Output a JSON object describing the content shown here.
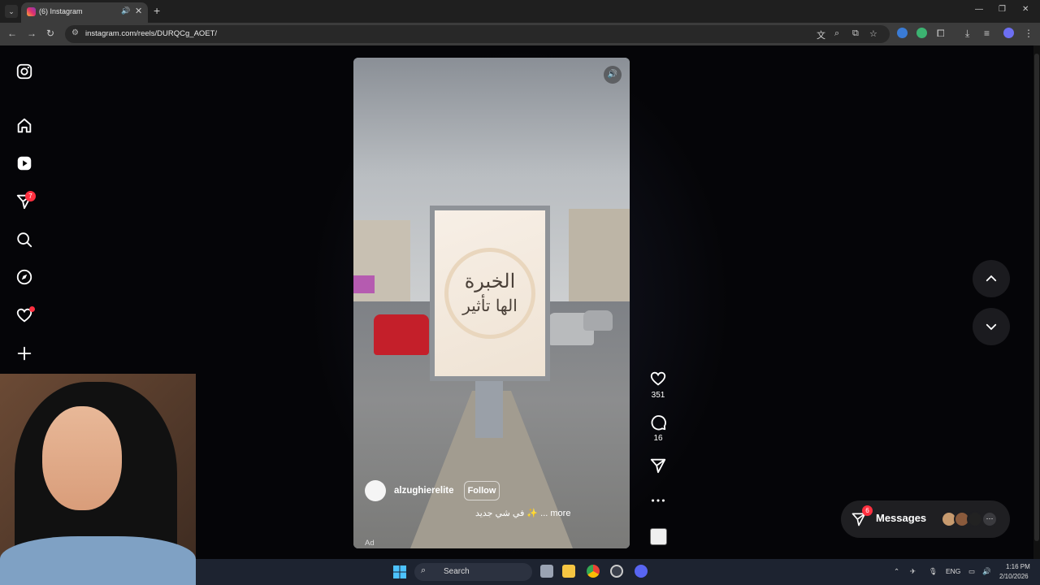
{
  "browser": {
    "tab_title": "(6) Instagram",
    "url": "instagram.com/reels/DURQCg_AOET/"
  },
  "sidebar": {
    "notifications_badge": "7"
  },
  "reel": {
    "billboard_line1": "الخبرة",
    "billboard_line2": "الها تأثير",
    "username": "alzughierelite",
    "follow_label": "Follow",
    "caption": "في شي جديد ✨ ... more",
    "ad_label": "Ad",
    "likes": "351",
    "comments": "16"
  },
  "messages": {
    "label": "Messages",
    "badge": "6"
  },
  "taskbar": {
    "search_label": "Search",
    "lang": "ENG",
    "time": "1:16 PM",
    "date": "2/10/2026"
  }
}
